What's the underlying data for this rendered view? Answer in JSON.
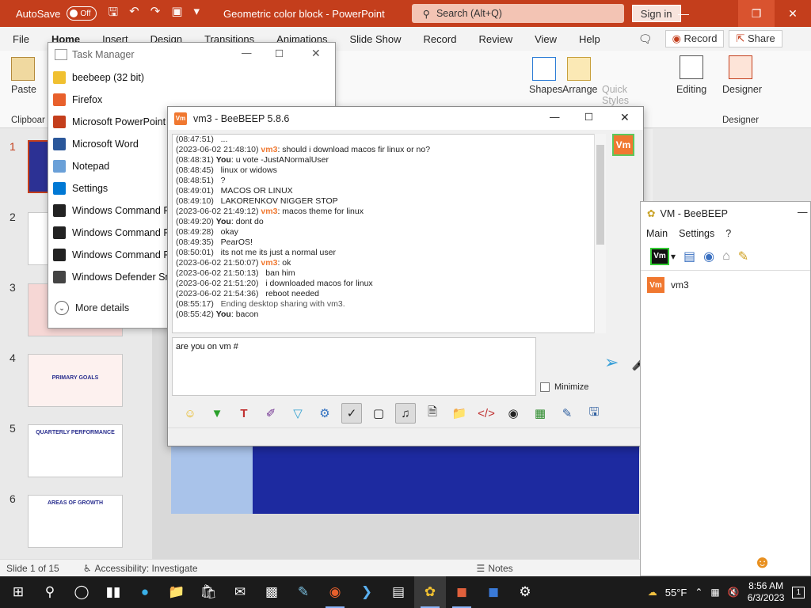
{
  "ppt": {
    "autosave_label": "AutoSave",
    "autosave_state": "Off",
    "doc_title": "Geometric color block  -  PowerPoint",
    "search_placeholder": "Search (Alt+Q)",
    "signin_label": "Sign in",
    "tabs": [
      "File",
      "Home",
      "Insert",
      "Design",
      "Transitions",
      "Animations",
      "Slide Show",
      "Record",
      "Review",
      "View",
      "Help"
    ],
    "record_button": "Record",
    "share_button": "Share",
    "ribbon": {
      "paste": "Paste",
      "clipboard": "Clipboar",
      "shapes": "Shapes",
      "arrange": "Arrange",
      "quick_styles": "Quick Styles",
      "editing": "Editing",
      "designer": "Designer",
      "designer_group": "Designer"
    },
    "thumb_numbers": [
      "1",
      "2",
      "3",
      "4",
      "5",
      "6"
    ],
    "thumb_titles": [
      "",
      "",
      "",
      "PRIMARY GOALS",
      "QUARTERLY PERFORMANCE",
      "AREAS OF GROWTH"
    ],
    "status": {
      "slide_of": "Slide 1 of 15",
      "accessibility": "Accessibility: Investigate",
      "notes": "Notes"
    }
  },
  "taskmgr": {
    "title": "Task Manager",
    "items": [
      {
        "label": "beebeep (32 bit)",
        "color": "#f0c030"
      },
      {
        "label": "Firefox",
        "color": "#e8602c"
      },
      {
        "label": "Microsoft PowerPoint",
        "color": "#c43e1c"
      },
      {
        "label": "Microsoft Word",
        "color": "#2b579a"
      },
      {
        "label": "Notepad",
        "color": "#6aa0d8"
      },
      {
        "label": "Settings",
        "color": "#0078d4"
      },
      {
        "label": "Windows Command Pr",
        "color": "#222222"
      },
      {
        "label": "Windows Command Pr",
        "color": "#222222"
      },
      {
        "label": "Windows Command Pr",
        "color": "#222222"
      },
      {
        "label": "Windows Defender Sm",
        "color": "#444444"
      }
    ],
    "more_details": "More details"
  },
  "chat": {
    "title": "vm3 - BeeBEEP 5.8.6",
    "log": [
      {
        "ts": "(08:47:51)",
        "who": "",
        "text": "..."
      },
      {
        "ts": "(2023-06-02 21:48:10)",
        "who": "vm3",
        "text": ": should i download macos fir linux or no?"
      },
      {
        "ts": "(08:48:31)",
        "who": "You",
        "text": ": u vote -JustANormalUser"
      },
      {
        "ts": "(08:48:45)",
        "who": "",
        "text": "linux or widows"
      },
      {
        "ts": "(08:48:51)",
        "who": "",
        "text": "?"
      },
      {
        "ts": "(08:49:01)",
        "who": "",
        "text": "MACOS OR LINUX"
      },
      {
        "ts": "(08:49:10)",
        "who": "",
        "text": "LAKORENKOV NIGGER STOP"
      },
      {
        "ts": "(2023-06-02 21:49:12)",
        "who": "vm3",
        "text": ": macos theme for linux"
      },
      {
        "ts": "(08:49:20)",
        "who": "You",
        "text": ": dont do"
      },
      {
        "ts": "(08:49:28)",
        "who": "",
        "text": "okay"
      },
      {
        "ts": "(08:49:35)",
        "who": "",
        "text": "PearOS!"
      },
      {
        "ts": "(08:50:01)",
        "who": "",
        "text": "its not me its just a normal user"
      },
      {
        "ts": "(2023-06-02 21:50:07)",
        "who": "vm3",
        "text": ": ok"
      },
      {
        "ts": "(2023-06-02 21:50:13)",
        "who": "",
        "text": "ban him"
      },
      {
        "ts": "(2023-06-02 21:51:20)",
        "who": "",
        "text": "i downloaded macos for linux"
      },
      {
        "ts": "(2023-06-02 21:54:36)",
        "who": "",
        "text": "reboot needed"
      },
      {
        "ts": "(08:55:17)",
        "who": "",
        "text": "Ending desktop sharing with vm3.",
        "system": true
      },
      {
        "ts": "(08:55:42)",
        "who": "You",
        "text": ": bacon"
      }
    ],
    "input_value": "are you on vm #",
    "minimize_label": "Minimize",
    "avatar_label": "Vm"
  },
  "vm_main": {
    "title": "VM - BeeBEEP",
    "menu": [
      "Main",
      "Settings",
      "?"
    ],
    "user": "vm3"
  },
  "taskbar": {
    "weather": "55°F",
    "time": "8:56 AM",
    "date": "6/3/2023",
    "notifications": "1"
  }
}
